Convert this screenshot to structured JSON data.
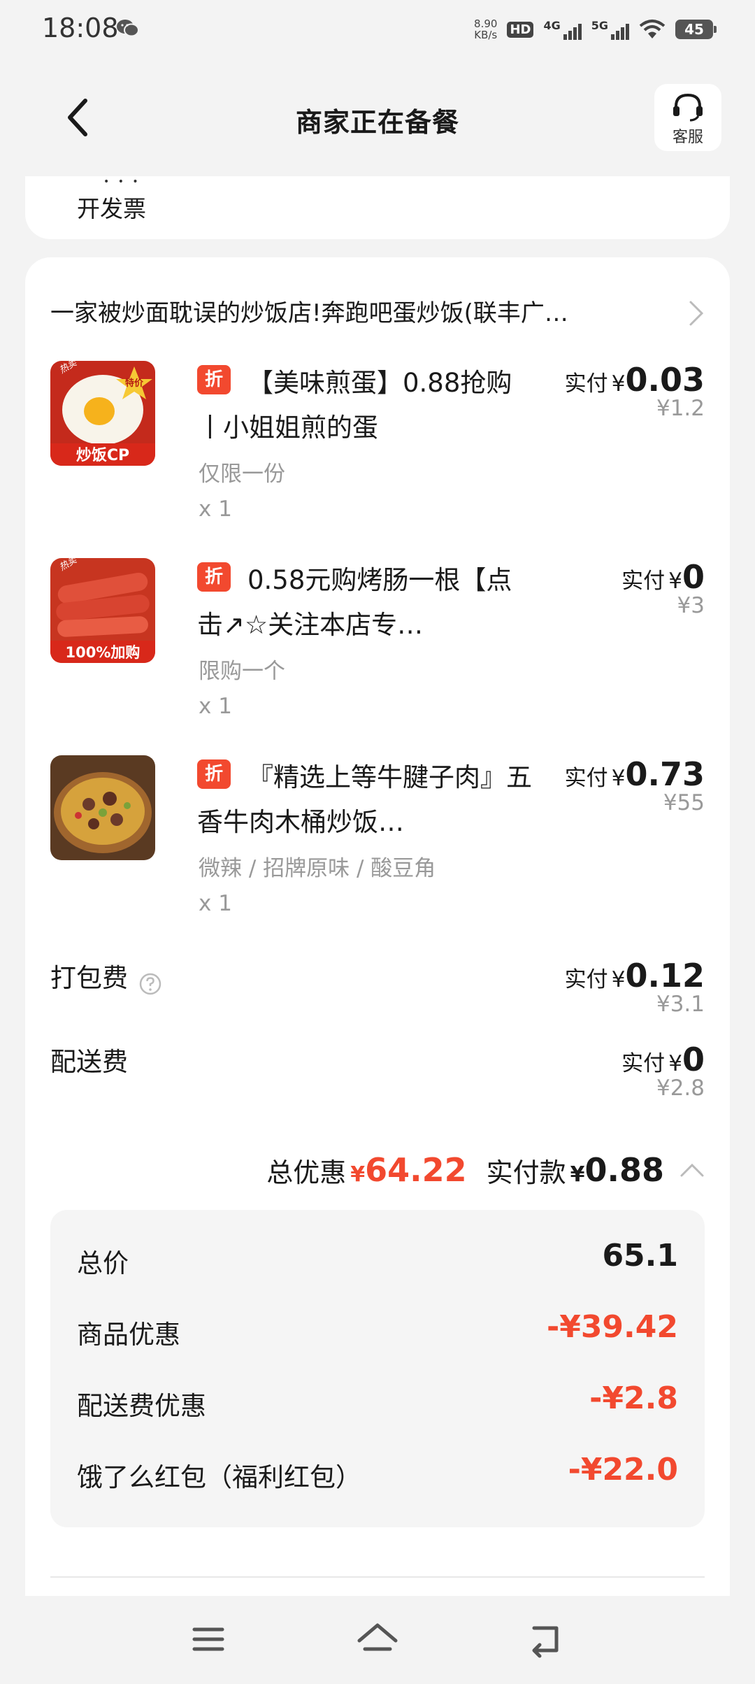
{
  "status_bar": {
    "time": "18:08",
    "net_speed_value": "8.90",
    "net_speed_unit": "KB/s",
    "hd_label": "HD",
    "sim1_label": "4G",
    "sim2_label": "5G",
    "battery": "45"
  },
  "header": {
    "title": "商家正在备餐",
    "service_label": "客服"
  },
  "invoice": {
    "label": "开发票"
  },
  "shop": {
    "name": "一家被炒面耽误的炒饭店!奔跑吧蛋炒饭(联丰广…"
  },
  "discount_badge": "折",
  "paid_prefix": "实付",
  "currency": "¥",
  "items": [
    {
      "title": "【美味煎蛋】0.88抢购丨小姐姐煎的蛋",
      "spec": "仅限一份",
      "qty": "x 1",
      "paid": "0.03",
      "original": "¥1.2",
      "thumb_text": "炒饭CP",
      "thumb_tag": "特价",
      "thumb_corner": "热卖"
    },
    {
      "title": "0.58元购烤肠一根【点击↗☆关注本店专…",
      "spec": "限购一个",
      "qty": "x 1",
      "paid": "0",
      "original": "¥3",
      "thumb_text": "100%加购",
      "thumb_corner": "热卖"
    },
    {
      "title": "『精选上等牛腱子肉』五香牛肉木桶炒饭…",
      "spec": "微辣 / 招牌原味 / 酸豆角",
      "qty": "x 1",
      "paid": "0.73",
      "original": "¥55"
    }
  ],
  "fees": [
    {
      "label": "打包费",
      "paid": "0.12",
      "original": "¥3.1"
    },
    {
      "label": "配送费",
      "paid": "0",
      "original": "¥2.8"
    }
  ],
  "summary": {
    "discount_label": "总优惠",
    "discount_value": "64.22",
    "total_label": "实付款",
    "total_value": "0.88"
  },
  "details": [
    {
      "label": "总价",
      "value": "65.1"
    },
    {
      "label": "商品优惠",
      "value": "-¥39.42"
    },
    {
      "label": "配送费优惠",
      "value": "-¥2.8"
    },
    {
      "label": "饿了么红包（福利红包）",
      "value": "-¥22.0"
    }
  ],
  "colors": {
    "accent": "#f2492f",
    "background": "#f3f3f3",
    "card": "#ffffff"
  }
}
